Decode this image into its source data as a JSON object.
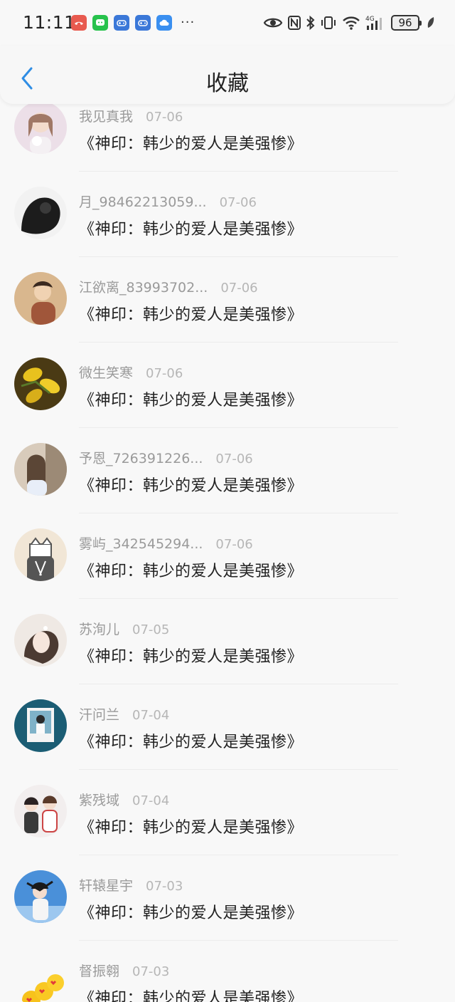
{
  "status_bar": {
    "time": "11:11",
    "battery": "96",
    "notification_icons": [
      "missed-call-icon",
      "message-icon",
      "game-controller-icon",
      "game-controller-icon",
      "cloud-icon"
    ],
    "system_icons": [
      "eye-icon",
      "nfc-icon",
      "bluetooth-icon",
      "vibrate-icon",
      "wifi-icon",
      "signal-4g-icon",
      "battery-icon",
      "leaf-icon"
    ],
    "more": "···"
  },
  "header": {
    "title": "收藏",
    "back_icon": "chevron-left-icon",
    "accent_color": "#2f8de4"
  },
  "items": [
    {
      "user": "我见真我",
      "date": "07-06",
      "book": "《神印：韩少的爱人是美强惨》",
      "avatar_color": "#e9d6e1"
    },
    {
      "user": "月_98462213059...",
      "date": "07-06",
      "book": "《神印：韩少的爱人是美强惨》",
      "avatar_color": "#2b2b2b"
    },
    {
      "user": "江欲离_83993702...",
      "date": "07-06",
      "book": "《神印：韩少的爱人是美强惨》",
      "avatar_color": "#c89a6d"
    },
    {
      "user": "微生笑寒",
      "date": "07-06",
      "book": "《神印：韩少的爱人是美强惨》",
      "avatar_color": "#c9a22a"
    },
    {
      "user": "予恩_726391226...",
      "date": "07-06",
      "book": "《神印：韩少的爱人是美强惨》",
      "avatar_color": "#c8b8a4"
    },
    {
      "user": "雾屿_342545294...",
      "date": "07-06",
      "book": "《神印：韩少的爱人是美强惨》",
      "avatar_color": "#e7ddd0"
    },
    {
      "user": "苏洵儿",
      "date": "07-05",
      "book": "《神印：韩少的爱人是美强惨》",
      "avatar_color": "#e8e2dc"
    },
    {
      "user": "汗问兰",
      "date": "07-04",
      "book": "《神印：韩少的爱人是美强惨》",
      "avatar_color": "#1f5f78"
    },
    {
      "user": "紫残域",
      "date": "07-04",
      "book": "《神印：韩少的爱人是美强惨》",
      "avatar_color": "#e8e3e3"
    },
    {
      "user": "轩辕星宇",
      "date": "07-03",
      "book": "《神印：韩少的爱人是美强惨》",
      "avatar_color": "#3e86c9"
    },
    {
      "user": "督振翱",
      "date": "07-03",
      "book": "《神印：韩少的爱人是美强惨》",
      "avatar_color": "#f5f5f5"
    }
  ]
}
